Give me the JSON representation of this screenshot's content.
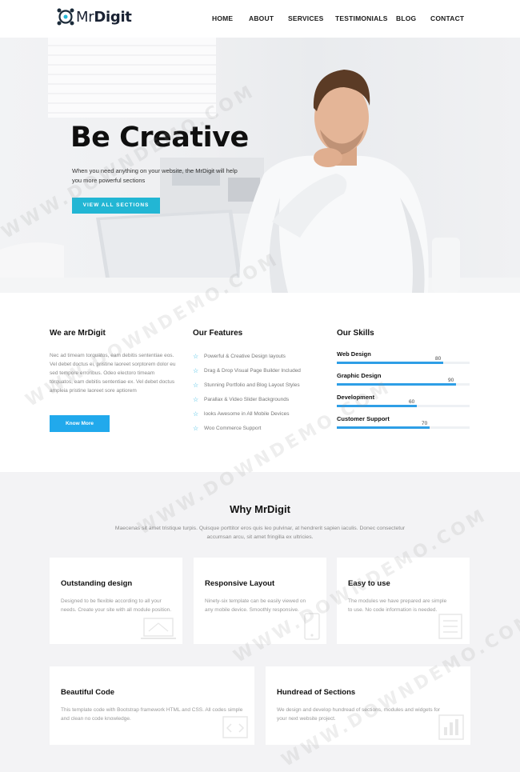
{
  "brand": {
    "prefix": "Mr",
    "name": "Digit"
  },
  "nav": {
    "items": [
      {
        "label": "HOME"
      },
      {
        "label": "ABOUT"
      },
      {
        "label": "SERVICES"
      },
      {
        "label": "TESTIMONIALS"
      },
      {
        "label": "BLOG"
      },
      {
        "label": "CONTACT"
      }
    ]
  },
  "hero": {
    "title": "Be Creative",
    "subtitle": "When you need anything on your website, the MrDigit will help you more powerful sections",
    "button": "VIEW ALL SECTIONS"
  },
  "about": {
    "title": "We are MrDigit",
    "text": "Nec ad timeam torquatos, eam debitis sententiae eos. Vel debet doctus ei, pristine laoreet sorptorem dolor eu sed tempore erroribus. Odeo electoro timeam torquatos, eam debitis sententiae ex. Vel debet doctus ampleia pristine laoreet sore aptiorem",
    "button": "Know More"
  },
  "features": {
    "title": "Our Features",
    "items": [
      "Powerful & Creative Design layouts",
      "Drag & Drop Visual Page Builder Included",
      "Stunning Portfolio and Blog Layout Styles",
      "Parallax & Video Slider Backgrounds",
      "looks Awesome in All Mobile Devices",
      "Woo Commerce Support"
    ]
  },
  "skills": {
    "title": "Our Skills",
    "items": [
      {
        "label": "Web Design",
        "value": 80
      },
      {
        "label": "Graphic Design",
        "value": 90
      },
      {
        "label": "Development",
        "value": 60
      },
      {
        "label": "Customer Support",
        "value": 70
      }
    ]
  },
  "why": {
    "title": "Why MrDigit",
    "subtitle": "Maecenas sit amet tristique turpis. Quisque porttitor eros quis leo pulvinar, at hendrerit sapien iaculis. Donec consectetur accumsan arcu, sit amet fringilla ex ultricies.",
    "cards": [
      {
        "title": "Outstanding design",
        "text": "Designed to be flexible according to all your needs. Create your site with all module position."
      },
      {
        "title": "Responsive Layout",
        "text": "Ninety-six template can be easily viewed on any mobile device. Smoothly responsive."
      },
      {
        "title": "Easy to use",
        "text": "The modules we have prepared are simple to use. No code information is needed."
      },
      {
        "title": "Beautiful Code",
        "text": "This template code with Bootstrap framework HTML and CSS. All codes simple and clean no code knowledge."
      },
      {
        "title": "Hundread of Sections",
        "text": "We design and develop hundread of sections, modules and widgets for your next website project."
      }
    ]
  },
  "watermark": "WWW.DOWNDEMO.COM",
  "colors": {
    "accent": "#22b6d4",
    "button": "#21a9ec",
    "skill": "#2e9ee6"
  },
  "icons": [
    "logo-icon",
    "star-icon",
    "laptop-icon",
    "mobile-icon",
    "list-icon",
    "code-icon",
    "chart-icon"
  ]
}
